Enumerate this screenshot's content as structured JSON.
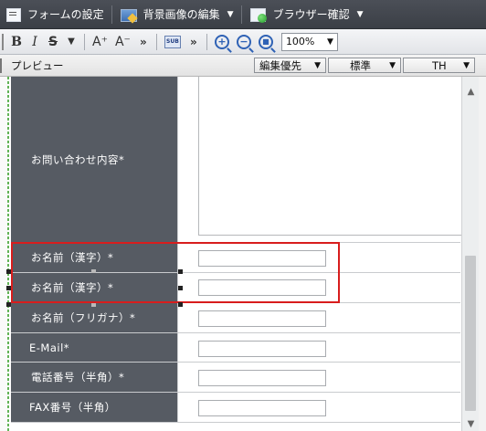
{
  "toolbar": {
    "form_settings": "フォームの設定",
    "edit_bg": "背景画像の編集",
    "browser_check": "ブラウザー確認"
  },
  "format": {
    "bold": "B",
    "italic": "I",
    "strike": "S",
    "grow": "A⁺",
    "shrink": "A⁻",
    "more": "»",
    "sub": "SUB",
    "zoom": "100%"
  },
  "preview": {
    "label": "プレビュー",
    "mode": "編集優先",
    "style": "標準",
    "cell": "TH"
  },
  "form": {
    "rows": [
      {
        "label": "お問い合わせ内容*"
      },
      {
        "label": "お名前（漢字）*"
      },
      {
        "label": "お名前（漢字）*"
      },
      {
        "label": "お名前（フリガナ）*"
      },
      {
        "label": "E-Mail*"
      },
      {
        "label": "電話番号（半角）*"
      },
      {
        "label": "FAX番号（半角）"
      }
    ]
  },
  "colors": {
    "label_bg": "#565b63",
    "selection": "#d81d1d",
    "toolbar_bg": "#3f434a"
  }
}
